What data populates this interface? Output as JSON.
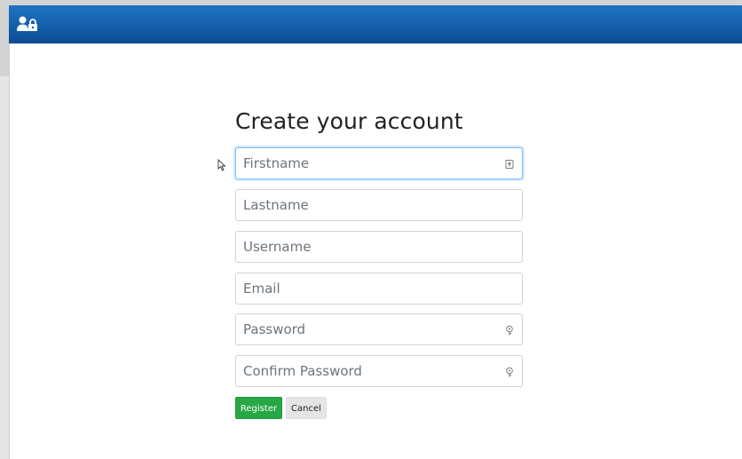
{
  "app_bar": {
    "icon": "user-lock-icon",
    "background": "#145eaa"
  },
  "form": {
    "title": "Create your account",
    "fields": [
      {
        "name": "firstname",
        "placeholder": "Firstname",
        "value": "",
        "icon": "autofill-key-icon",
        "focused": true
      },
      {
        "name": "lastname",
        "placeholder": "Lastname",
        "value": ""
      },
      {
        "name": "username",
        "placeholder": "Username",
        "value": ""
      },
      {
        "name": "email",
        "placeholder": "Email",
        "value": ""
      },
      {
        "name": "password",
        "placeholder": "Password",
        "value": "",
        "icon": "password-key-icon"
      },
      {
        "name": "confirm_password",
        "placeholder": "Confirm Password",
        "value": "",
        "icon": "password-key-icon"
      }
    ],
    "register_label": "Register",
    "cancel_label": "Cancel",
    "register_color": "#28a745",
    "cancel_color": "#e4e5e7"
  }
}
